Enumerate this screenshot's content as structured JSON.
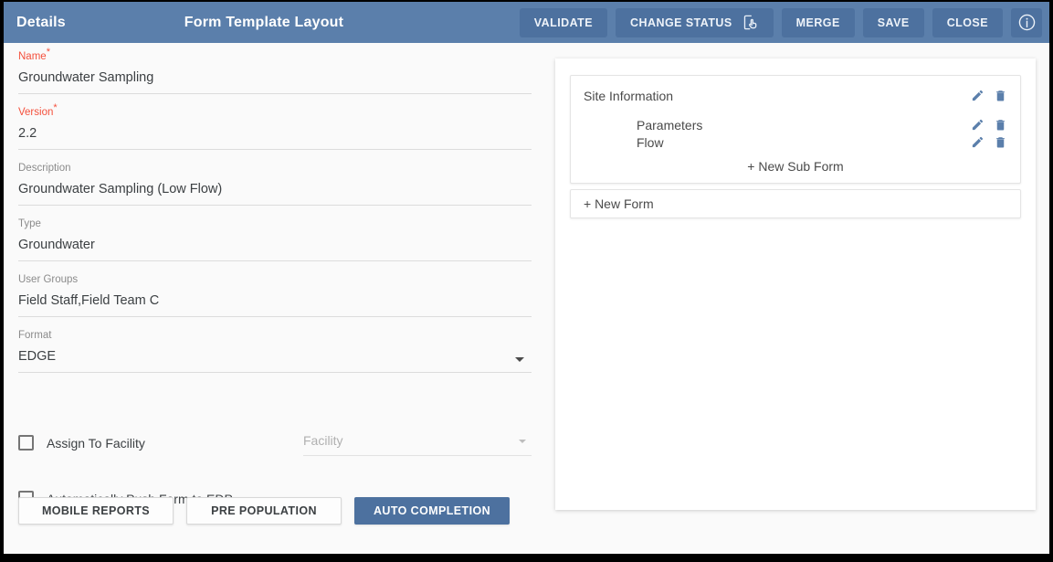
{
  "header": {
    "left_title": "Details",
    "center_title": "Form Template Layout",
    "buttons": [
      {
        "label": "VALIDATE",
        "icon": ""
      },
      {
        "label": "CHANGE STATUS",
        "icon": "tap-app-icon"
      },
      {
        "label": "MERGE",
        "icon": ""
      },
      {
        "label": "SAVE",
        "icon": ""
      },
      {
        "label": "CLOSE",
        "icon": ""
      }
    ],
    "info_icon": "info-circle-icon",
    "background_color": "#5b7fab",
    "button_color": "#4d719f"
  },
  "details_form": {
    "fields": [
      {
        "label": "Name",
        "required": true,
        "value": "Groundwater Sampling",
        "type": "text"
      },
      {
        "label": "Version",
        "required": true,
        "value": "2.2",
        "type": "text"
      },
      {
        "label": "Description",
        "required": false,
        "value": "Groundwater Sampling (Low Flow)",
        "type": "text"
      },
      {
        "label": "Type",
        "required": false,
        "value": "Groundwater",
        "type": "text"
      },
      {
        "label": "User Groups",
        "required": false,
        "value": "Field Staff,Field Team C",
        "type": "text"
      },
      {
        "label": "Format",
        "required": false,
        "value": "EDGE",
        "type": "select"
      }
    ],
    "checkboxes": [
      {
        "label": "Assign To Facility",
        "checked": false
      },
      {
        "label": "Automatically Push Form to EDP",
        "checked": false
      }
    ],
    "facility_select": {
      "placeholder": "Facility",
      "value": "",
      "disabled": true
    },
    "required_marker": "*"
  },
  "bottom_tabs": [
    {
      "label": "MOBILE REPORTS",
      "active": false
    },
    {
      "label": "PRE POPULATION",
      "active": false
    },
    {
      "label": "AUTO COMPLETION",
      "active": true
    }
  ],
  "form_layout": {
    "parent": {
      "label": "Site Information",
      "edit_icon": "pencil-icon",
      "delete_icon": "trash-icon"
    },
    "children": [
      {
        "label": "Parameters",
        "edit_icon": "pencil-icon",
        "delete_icon": "trash-icon"
      },
      {
        "label": "Flow",
        "edit_icon": "pencil-icon",
        "delete_icon": "trash-icon"
      }
    ],
    "new_sub_form_label": "+ New Sub Form",
    "new_form_label": "+ New Form",
    "icon_color": "#5b7fab"
  }
}
